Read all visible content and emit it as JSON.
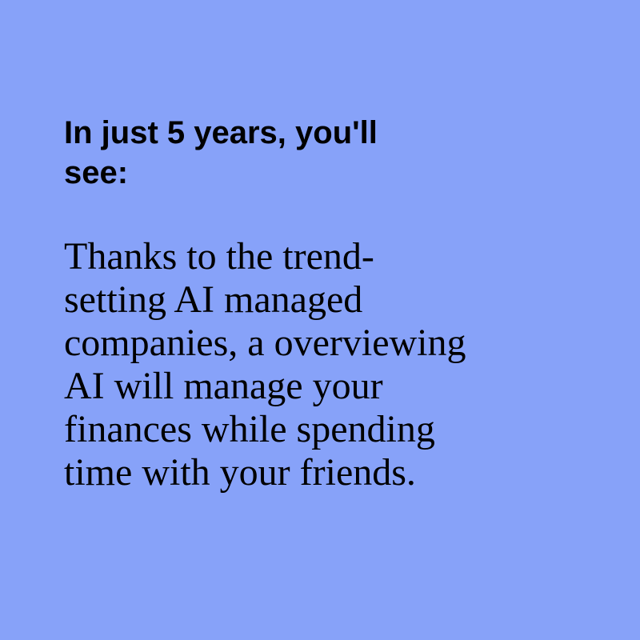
{
  "heading": {
    "lines": [
      "In just 5 years, you'll",
      "see:"
    ]
  },
  "body": {
    "lines": [
      "Thanks to the trend-",
      "setting AI managed",
      "companies, a overviewing",
      "AI will manage your",
      "finances while spending",
      "time with your friends."
    ]
  },
  "colors": {
    "background": "#87a2f9",
    "text": "#000000"
  }
}
